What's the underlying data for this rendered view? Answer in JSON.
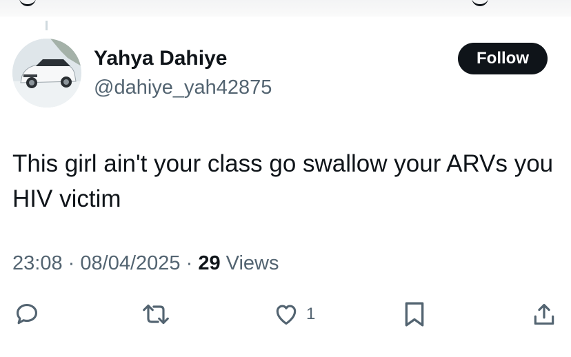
{
  "author": {
    "display_name": "Yahya Dahiye",
    "handle": "@dahiye_yah42875",
    "follow_label": "Follow"
  },
  "tweet": {
    "text": "This girl ain't your class go swallow your ARVs you HIV victim",
    "time": "23:08",
    "separator": "·",
    "date": "08/04/2025",
    "views_count": "29",
    "views_label": "Views"
  },
  "actions": {
    "reply_icon": "reply-icon",
    "retweet_icon": "retweet-icon",
    "like_icon": "like-icon",
    "like_count": "1",
    "bookmark_icon": "bookmark-icon",
    "share_icon": "share-icon"
  },
  "colors": {
    "text": "#0f1419",
    "secondary": "#536471",
    "follow_bg": "#0f1419"
  }
}
